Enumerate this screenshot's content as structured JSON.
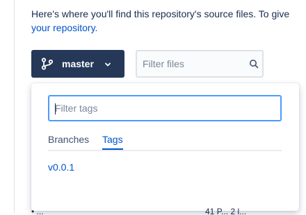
{
  "intro": {
    "line1": "Here's where you'll find this repository's source files. To give",
    "link": "your repository."
  },
  "branch_button": {
    "label": "master",
    "icon": "branch-icon"
  },
  "filter_files": {
    "placeholder": "Filter files",
    "icon": "search-icon"
  },
  "dropdown": {
    "filter_placeholder": "Filter tags",
    "tabs": [
      {
        "label": "Branches",
        "active": false
      },
      {
        "label": "Tags",
        "active": true
      }
    ],
    "items": [
      {
        "label": "v0.0.1"
      }
    ]
  },
  "bottom": {
    "left": "• ...",
    "right": "41 P... 2 l..."
  },
  "colors": {
    "primary": "#253858",
    "accent": "#0052CC",
    "focus": "#4C9AFF",
    "text": "#172B4D"
  }
}
